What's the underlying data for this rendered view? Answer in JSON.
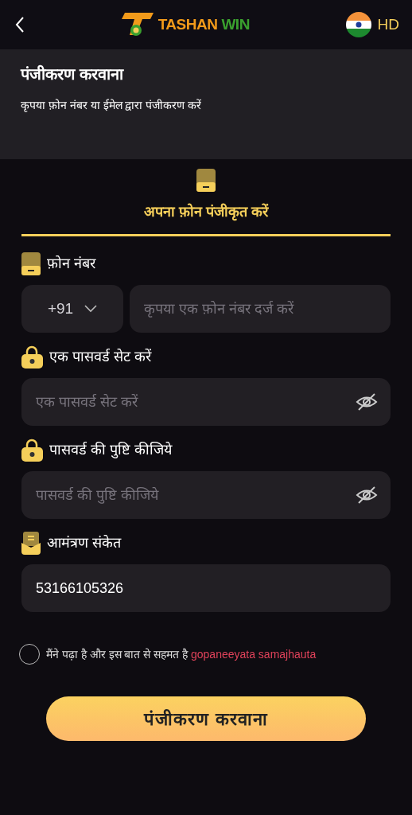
{
  "header": {
    "logo_word_1": "TASHAN",
    "logo_word_2": "WIN",
    "language": "HD"
  },
  "intro": {
    "title": "पंजीकरण करवाना",
    "subtitle": "कृपया फ़ोन नंबर या ईमेल द्वारा पंजीकरण करें"
  },
  "tabs": [
    {
      "label": "अपना फ़ोन पंजीकृत करें",
      "selected": true
    }
  ],
  "fields": [
    {
      "kind": "phone",
      "label": "फ़ोन नंबर",
      "country_code": "+91",
      "placeholder": "कृपया एक फ़ोन नंबर दर्ज करें"
    },
    {
      "kind": "password",
      "label": "एक पासवर्ड सेट करें",
      "placeholder": "एक पासवर्ड सेट करें",
      "show_password": false
    },
    {
      "kind": "password",
      "label": "पासवर्ड की पुष्टि कीजिये",
      "placeholder": "पासवर्ड की पुष्टि कीजिये",
      "show_password": false
    },
    {
      "kind": "code",
      "label": "आमंत्रण संकेत",
      "value": "53166105326"
    }
  ],
  "agreement": {
    "checked": false,
    "text": "मैंने पढ़ा है और इस बात से सहमत है",
    "link": "gopaneeyata samajhauta"
  },
  "submit_button": "पंजीकरण करवाना"
}
